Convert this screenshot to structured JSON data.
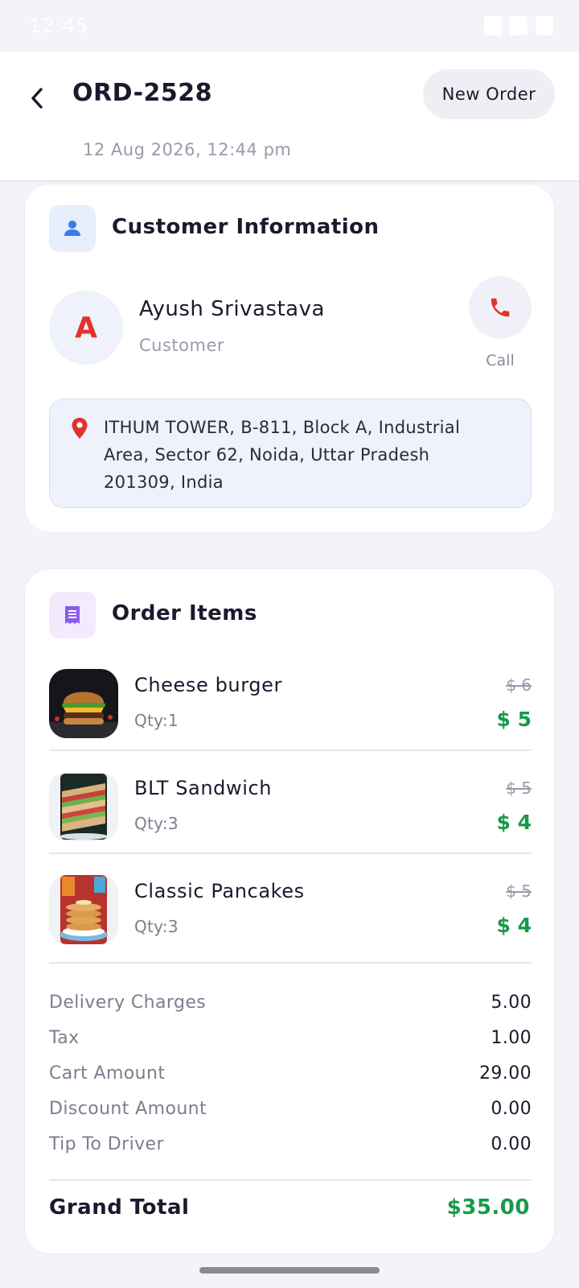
{
  "status_bar": {
    "time": "12:45"
  },
  "header": {
    "order_id": "ORD-2528",
    "date": "12 Aug 2026, 12:44 pm",
    "new_order_label": "New Order"
  },
  "customer_card": {
    "title": "Customer Information",
    "avatar_letter": "A",
    "name": "Ayush Srivastava",
    "role": "Customer",
    "call_label": "Call",
    "address": "ITHUM TOWER, B-811, Block A, Industrial Area, Sector 62, Noida, Uttar Pradesh 201309, India"
  },
  "order_card": {
    "title": "Order Items",
    "items": [
      {
        "name": "Cheese burger",
        "qty": "Qty:1",
        "old_price": "$ 6",
        "price": "$ 5"
      },
      {
        "name": "BLT Sandwich",
        "qty": "Qty:3",
        "old_price": "$ 5",
        "price": "$ 4"
      },
      {
        "name": "Classic Pancakes",
        "qty": "Qty:3",
        "old_price": "$ 5",
        "price": "$ 4"
      }
    ],
    "charges": [
      {
        "label": "Delivery Charges",
        "value": "5.00"
      },
      {
        "label": "Tax",
        "value": "1.00"
      },
      {
        "label": "Cart Amount",
        "value": "29.00"
      },
      {
        "label": "Discount Amount",
        "value": "0.00"
      },
      {
        "label": "Tip To Driver",
        "value": "0.00"
      }
    ],
    "grand_total_label": "Grand Total",
    "grand_total_value": "$35.00"
  },
  "colors": {
    "accent_green": "#169a4a",
    "call_red": "#e0332b",
    "customer_icon_blue": "#3b7bea",
    "order_icon_purple": "#8a5cf0"
  }
}
